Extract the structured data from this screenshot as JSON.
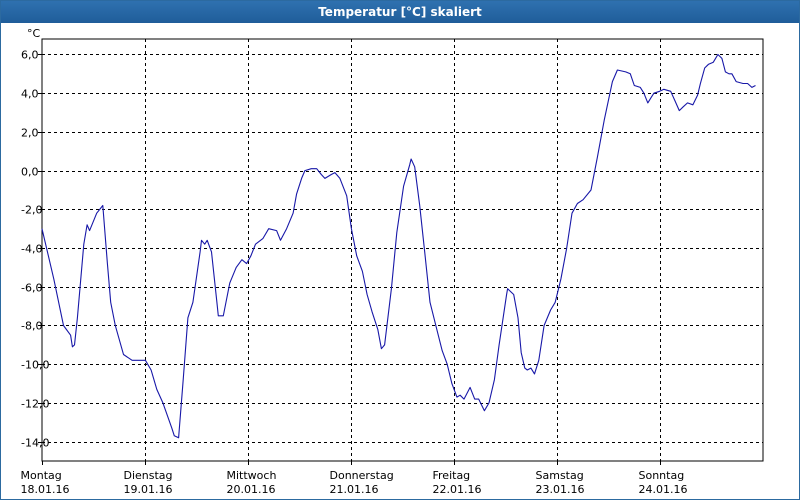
{
  "window": {
    "title": "Temperatur [°C] skaliert"
  },
  "chart_data": {
    "type": "line",
    "title": "Temperatur [°C] skaliert",
    "ylabel": "°C",
    "xlabel": "",
    "ylim": [
      -15,
      6.8
    ],
    "yticks": [
      6.0,
      4.0,
      2.0,
      0.0,
      -2.0,
      -4.0,
      -6.0,
      -8.0,
      -10.0,
      -12.0,
      -14.0
    ],
    "ytick_labels": [
      "6,0",
      "4,0",
      "2,0",
      "0,0",
      "-2,0",
      "-4,0",
      "-6,0",
      "-8,0",
      "-10,0",
      "-12,0",
      "-14,0"
    ],
    "xlim": [
      "18.01.16 00:00",
      "25.01.16 00:00"
    ],
    "x_ticks": [
      {
        "day": "Montag",
        "date": "18.01.16"
      },
      {
        "day": "Dienstag",
        "date": "19.01.16"
      },
      {
        "day": "Mittwoch",
        "date": "20.01.16"
      },
      {
        "day": "Donnerstag",
        "date": "21.01.16"
      },
      {
        "day": "Freitag",
        "date": "22.01.16"
      },
      {
        "day": "Samstag",
        "date": "23.01.16"
      },
      {
        "day": "Sonntag",
        "date": "24.01.16"
      }
    ],
    "grid": true,
    "color": "#1818a8",
    "series": [
      {
        "values": [
          [
            "18.01.16 00:00",
            -3.0
          ],
          [
            "18.01.16 02:45",
            -5.6
          ],
          [
            "18.01.16 05:00",
            -8.0
          ],
          [
            "18.01.16 06:40",
            -8.5
          ],
          [
            "18.01.16 07:05",
            -9.1
          ],
          [
            "18.01.16 07:35",
            -9.0
          ],
          [
            "18.01.16 08:15",
            -7.6
          ],
          [
            "18.01.16 09:45",
            -3.8
          ],
          [
            "18.01.16 10:30",
            -2.8
          ],
          [
            "18.01.16 11:05",
            -3.1
          ],
          [
            "18.01.16 12:45",
            -2.2
          ],
          [
            "18.01.16 14:10",
            -1.8
          ],
          [
            "18.01.16 15:15",
            -4.8
          ],
          [
            "18.01.16 16:00",
            -6.8
          ],
          [
            "18.01.16 17:05",
            -8.0
          ],
          [
            "18.01.16 19:00",
            -9.5
          ],
          [
            "18.01.16 21:00",
            -9.8
          ],
          [
            "19.01.16 00:05",
            -9.8
          ],
          [
            "19.01.16 01:25",
            -10.3
          ],
          [
            "19.01.16 02:45",
            -11.3
          ],
          [
            "19.01.16 04:10",
            -12.0
          ],
          [
            "19.01.16 06:15",
            -13.3
          ],
          [
            "19.01.16 06:50",
            -13.7
          ],
          [
            "19.01.16 07:50",
            -13.8
          ],
          [
            "19.01.16 08:50",
            -11.0
          ],
          [
            "19.01.16 10:00",
            -7.6
          ],
          [
            "19.01.16 11:10",
            -6.8
          ],
          [
            "19.01.16 12:50",
            -4.2
          ],
          [
            "19.01.16 13:10",
            -3.6
          ],
          [
            "19.01.16 13:55",
            -3.8
          ],
          [
            "19.01.16 14:30",
            -3.6
          ],
          [
            "19.01.16 15:30",
            -4.2
          ],
          [
            "19.01.16 16:45",
            -6.8
          ],
          [
            "19.01.16 17:05",
            -7.5
          ],
          [
            "19.01.16 18:15",
            -7.5
          ],
          [
            "19.01.16 19:45",
            -5.8
          ],
          [
            "19.01.16 21:15",
            -5.0
          ],
          [
            "19.01.16 22:35",
            -4.6
          ],
          [
            "19.01.16 23:40",
            -4.8
          ],
          [
            "20.01.16 00:40",
            -4.4
          ],
          [
            "20.01.16 01:45",
            -3.8
          ],
          [
            "20.01.16 03:30",
            -3.5
          ],
          [
            "20.01.16 04:50",
            -3.0
          ],
          [
            "20.01.16 06:40",
            -3.1
          ],
          [
            "20.01.16 07:35",
            -3.6
          ],
          [
            "20.01.16 09:00",
            -3.0
          ],
          [
            "20.01.16 10:30",
            -2.2
          ],
          [
            "20.01.16 11:20",
            -1.2
          ],
          [
            "20.01.16 12:30",
            -0.4
          ],
          [
            "20.01.16 13:15",
            0.0
          ],
          [
            "20.01.16 14:45",
            0.1
          ],
          [
            "20.01.16 16:00",
            0.1
          ],
          [
            "20.01.16 17:05",
            -0.2
          ],
          [
            "20.01.16 17:55",
            -0.4
          ],
          [
            "20.01.16 19:25",
            -0.2
          ],
          [
            "20.01.16 20:15",
            -0.1
          ],
          [
            "20.01.16 21:25",
            -0.4
          ],
          [
            "20.01.16 23:00",
            -1.3
          ],
          [
            "21.01.16 00:05",
            -3.0
          ],
          [
            "21.01.16 01:20",
            -4.4
          ],
          [
            "21.01.16 02:40",
            -5.2
          ],
          [
            "21.01.16 03:45",
            -6.4
          ],
          [
            "21.01.16 04:55",
            -7.3
          ],
          [
            "21.01.16 06:15",
            -8.2
          ],
          [
            "21.01.16 07:05",
            -9.2
          ],
          [
            "21.01.16 07:50",
            -9.0
          ],
          [
            "21.01.16 09:25",
            -6.1
          ],
          [
            "21.01.16 10:40",
            -3.2
          ],
          [
            "21.01.16 12:15",
            -0.8
          ],
          [
            "21.01.16 13:40",
            0.3
          ],
          [
            "21.01.16 14:00",
            0.6
          ],
          [
            "21.01.16 14:50",
            0.2
          ],
          [
            "21.01.16 16:00",
            -1.8
          ],
          [
            "21.01.16 17:10",
            -4.2
          ],
          [
            "21.01.16 18:25",
            -6.8
          ],
          [
            "21.01.16 20:00",
            -8.2
          ],
          [
            "21.01.16 21:15",
            -9.3
          ],
          [
            "21.01.16 22:25",
            -10.0
          ],
          [
            "21.01.16 23:30",
            -11.0
          ],
          [
            "22.01.16 00:40",
            -11.7
          ],
          [
            "22.01.16 01:25",
            -11.6
          ],
          [
            "22.01.16 02:20",
            -11.8
          ],
          [
            "22.01.16 03:45",
            -11.2
          ],
          [
            "22.01.16 04:50",
            -11.8
          ],
          [
            "22.01.16 05:45",
            -11.8
          ],
          [
            "22.01.16 07:05",
            -12.4
          ],
          [
            "22.01.16 08:10",
            -12.0
          ],
          [
            "22.01.16 09:25",
            -10.8
          ],
          [
            "22.01.16 10:30",
            -9.0
          ],
          [
            "22.01.16 12:15",
            -6.4
          ],
          [
            "22.01.16 12:30",
            -6.1
          ],
          [
            "22.01.16 13:55",
            -6.4
          ],
          [
            "22.01.16 14:55",
            -7.6
          ],
          [
            "22.01.16 15:40",
            -9.4
          ],
          [
            "22.01.16 16:30",
            -10.2
          ],
          [
            "22.01.16 17:05",
            -10.3
          ],
          [
            "22.01.16 17:55",
            -10.2
          ],
          [
            "22.01.16 18:45",
            -10.5
          ],
          [
            "22.01.16 19:45",
            -9.8
          ],
          [
            "22.01.16 21:00",
            -8.0
          ],
          [
            "22.01.16 22:30",
            -7.2
          ],
          [
            "22.01.16 23:35",
            -6.8
          ],
          [
            "23.01.16 00:55",
            -5.6
          ],
          [
            "23.01.16 02:15",
            -4.0
          ],
          [
            "23.01.16 03:30",
            -2.2
          ],
          [
            "23.01.16 04:45",
            -1.7
          ],
          [
            "23.01.16 06:05",
            -1.5
          ],
          [
            "23.01.16 07:55",
            -1.0
          ],
          [
            "23.01.16 09:25",
            0.7
          ],
          [
            "23.01.16 11:00",
            2.6
          ],
          [
            "23.01.16 12:55",
            4.6
          ],
          [
            "23.01.16 14:05",
            5.2
          ],
          [
            "23.01.16 16:00",
            5.1
          ],
          [
            "23.01.16 17:05",
            5.0
          ],
          [
            "23.01.16 18:00",
            4.4
          ],
          [
            "23.01.16 19:25",
            4.3
          ],
          [
            "23.01.16 20:15",
            4.0
          ],
          [
            "23.01.16 21:10",
            3.5
          ],
          [
            "23.01.16 22:00",
            3.8
          ],
          [
            "23.01.16 22:35",
            4.0
          ],
          [
            "23.01.16 23:55",
            4.1
          ],
          [
            "24.01.16 00:55",
            4.2
          ],
          [
            "24.01.16 02:30",
            4.1
          ],
          [
            "24.01.16 03:30",
            3.6
          ],
          [
            "24.01.16 04:30",
            3.1
          ],
          [
            "24.01.16 05:25",
            3.3
          ],
          [
            "24.01.16 06:25",
            3.5
          ],
          [
            "24.01.16 07:40",
            3.4
          ],
          [
            "24.01.16 08:45",
            3.9
          ],
          [
            "24.01.16 09:25",
            4.5
          ],
          [
            "24.01.16 10:25",
            5.3
          ],
          [
            "24.01.16 11:20",
            5.5
          ],
          [
            "24.01.16 12:25",
            5.6
          ],
          [
            "24.01.16 13:30",
            6.0
          ],
          [
            "24.01.16 14:25",
            5.8
          ],
          [
            "24.01.16 15:15",
            5.1
          ],
          [
            "24.01.16 16:05",
            5.0
          ],
          [
            "24.01.16 16:45",
            5.0
          ],
          [
            "24.01.16 17:45",
            4.6
          ],
          [
            "24.01.16 19:20",
            4.5
          ],
          [
            "24.01.16 20:25",
            4.5
          ],
          [
            "24.01.16 21:25",
            4.3
          ],
          [
            "24.01.16 22:15",
            4.4
          ]
        ]
      }
    ]
  }
}
